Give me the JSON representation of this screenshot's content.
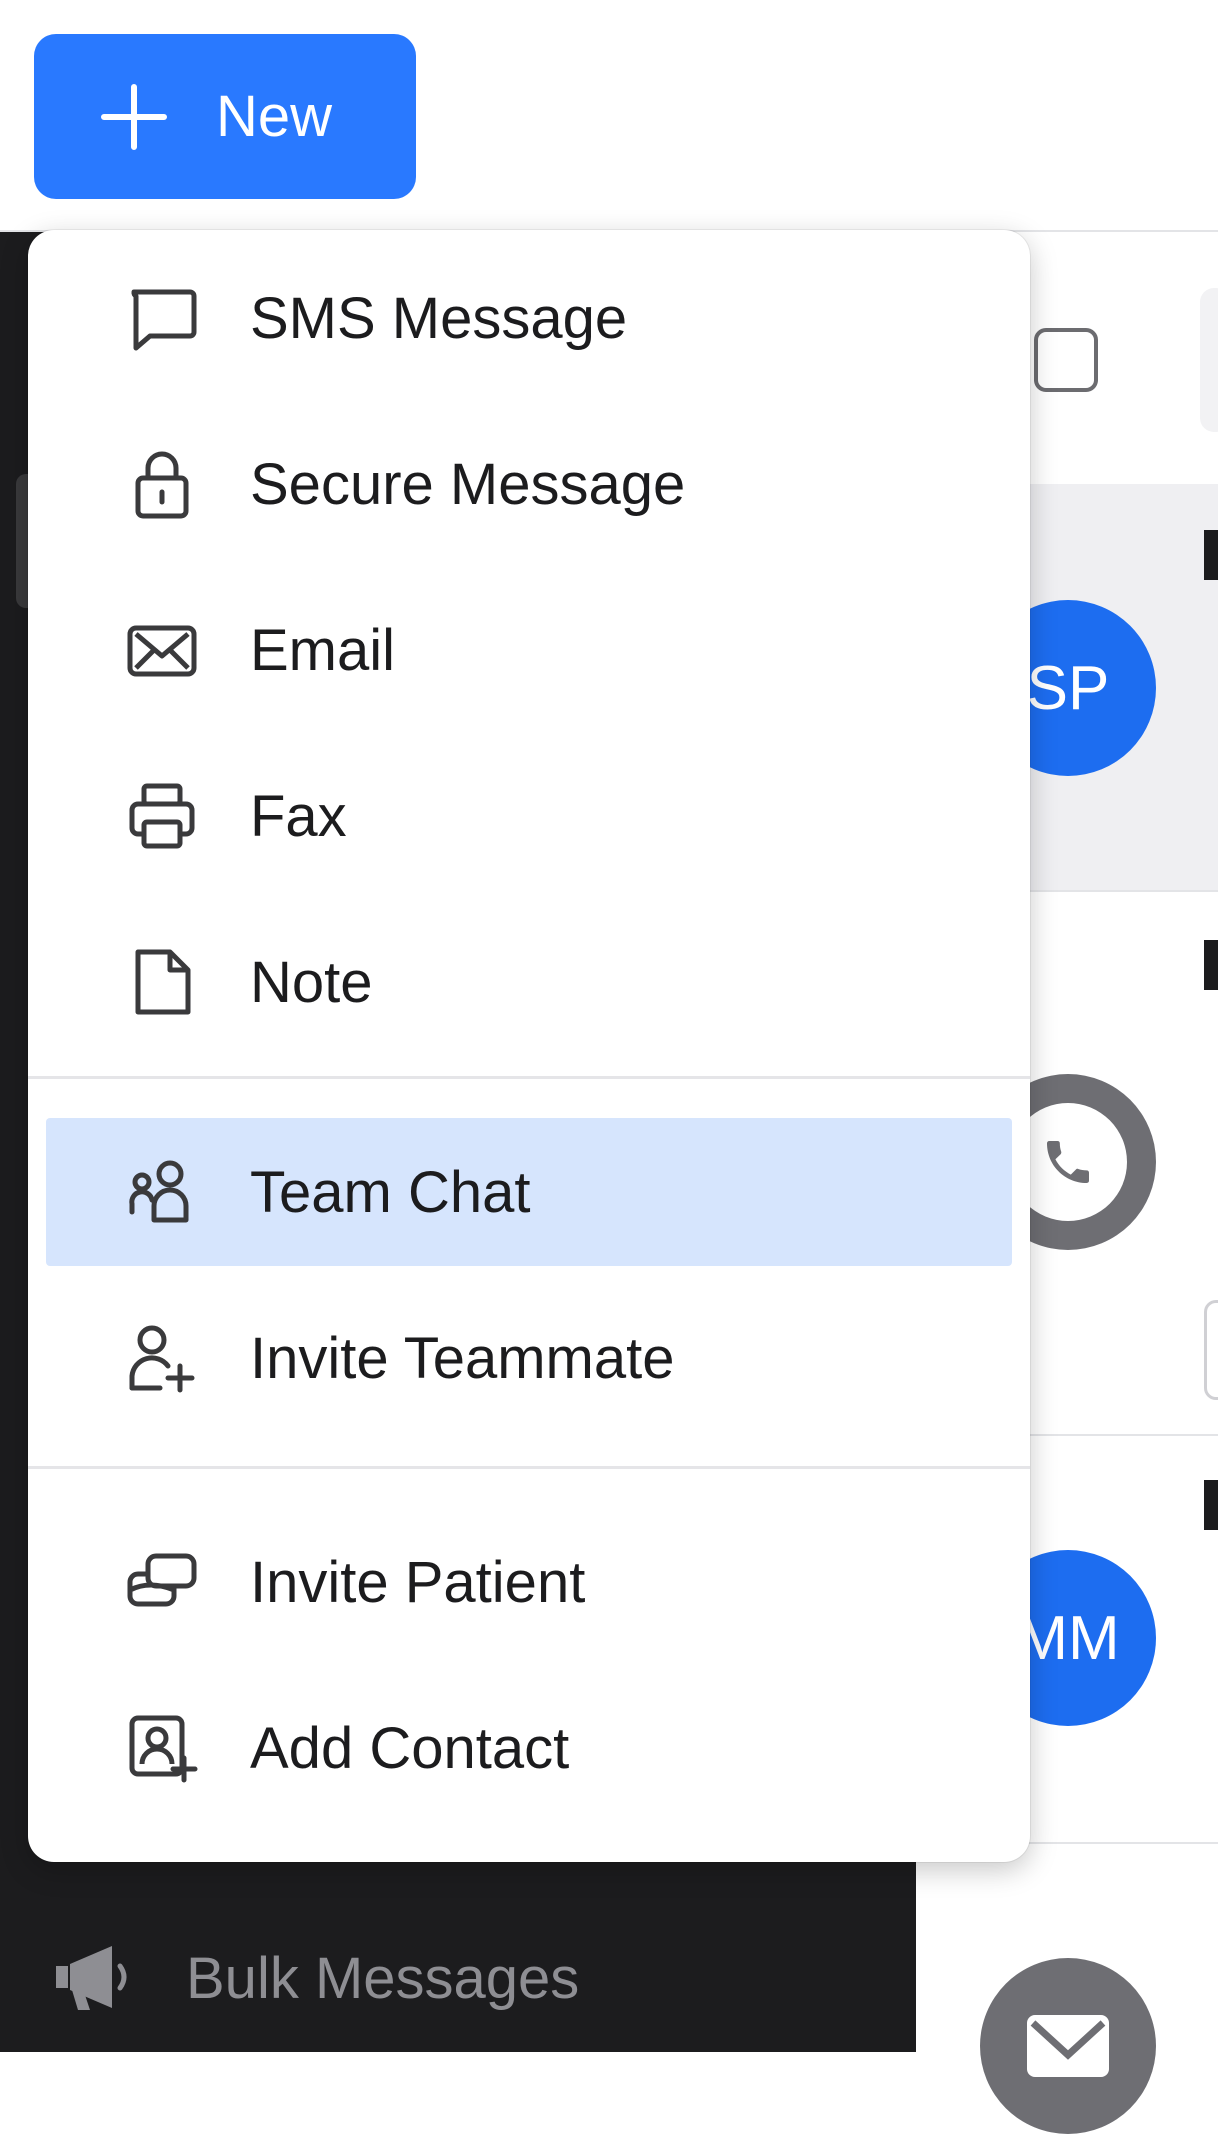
{
  "toolbar": {
    "new_label": "New"
  },
  "menu": {
    "items": [
      {
        "label": "SMS Message",
        "icon": "chat-bubble-icon"
      },
      {
        "label": "Secure Message",
        "icon": "lock-icon"
      },
      {
        "label": "Email",
        "icon": "envelope-icon"
      },
      {
        "label": "Fax",
        "icon": "printer-icon"
      },
      {
        "label": "Note",
        "icon": "document-icon"
      },
      {
        "label": "Team Chat",
        "icon": "team-icon"
      },
      {
        "label": "Invite Teammate",
        "icon": "user-plus-icon"
      },
      {
        "label": "Invite Patient",
        "icon": "invite-patient-icon"
      },
      {
        "label": "Add Contact",
        "icon": "contact-plus-icon"
      }
    ],
    "highlighted": "Team Chat"
  },
  "sidebar": {
    "bulk_label": "Bulk Messages"
  },
  "list": {
    "avatars": [
      "SP",
      "MM"
    ]
  },
  "colors": {
    "accent": "#2979ff",
    "highlight": "#d6e5fd",
    "sidebar": "#1c1c1e",
    "avatar_blue": "#1d6df0",
    "avatar_gray": "#6e6e73"
  }
}
